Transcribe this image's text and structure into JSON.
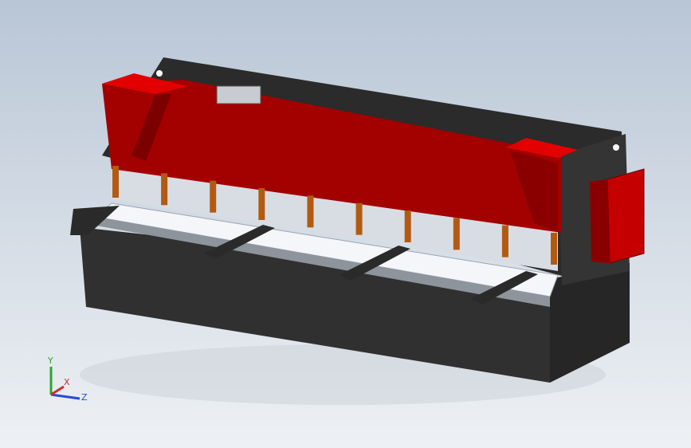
{
  "viewport": {
    "background_top": "#b9c6d6",
    "background_bottom": "#eef1f4"
  },
  "machine": {
    "body_color": "#2f2f2f",
    "body_dark": "#222222",
    "blade_beam_color": "#a30000",
    "red_caps_color": "#e30000",
    "table_color": "#f4f6fa",
    "finger_color": "#b25a12",
    "control_box_color": "#c40000"
  },
  "triad": {
    "y_label": "Y",
    "x_label": "X",
    "z_label": "Z",
    "y_color": "#2aa82a",
    "x_color": "#d22a2a",
    "z_color": "#2a4ad2"
  }
}
